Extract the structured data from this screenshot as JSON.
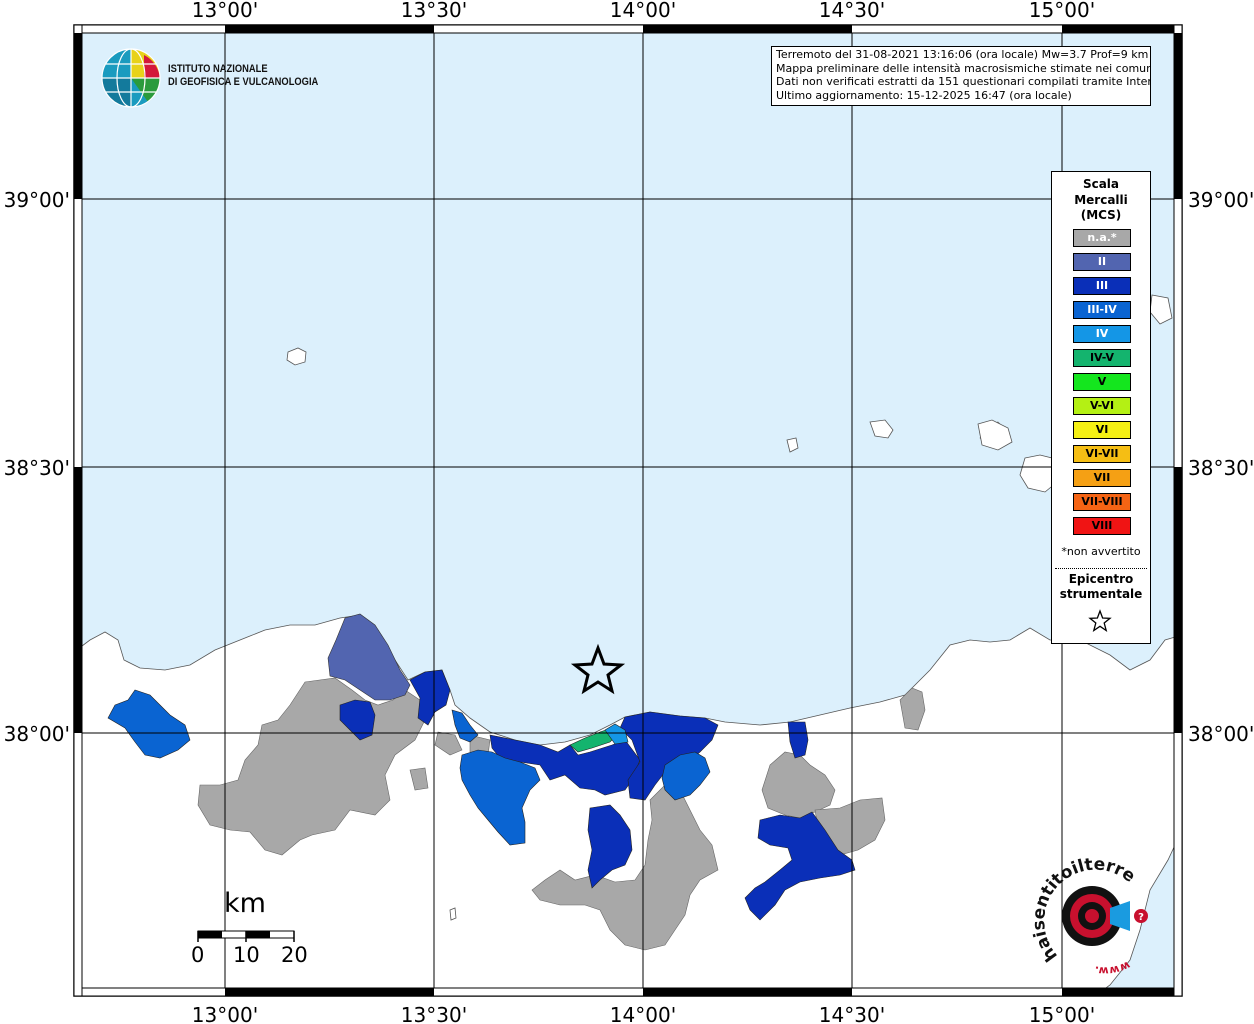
{
  "map": {
    "lon_ticks": [
      "13°00'",
      "13°30'",
      "14°00'",
      "14°30'",
      "15°00'"
    ],
    "lat_ticks": [
      "39°00'",
      "38°30'",
      "38°00'"
    ],
    "sea_color": "#dcf0fc",
    "land_color": "#ffffff",
    "no_data_color": "#a8a8a8"
  },
  "info": {
    "line1": "Terremoto del 31-08-2021 13:16:06 (ora locale) Mw=3.7 Prof=9 km",
    "line2": "Mappa preliminare delle intensità macrosismiche stimate nei comuni",
    "line3": "Dati non verificati estratti da 151 questionari compilati tramite Internet.",
    "line4": "Ultimo aggiornamento: 15-12-2025 16:47 (ora locale)"
  },
  "legend": {
    "title_line1": "Scala",
    "title_line2": "Mercalli",
    "title_line3": "(MCS)",
    "classes": [
      {
        "label": "n.a.*",
        "color": "#a8a8a8"
      },
      {
        "label": "II",
        "color": "#5265b0"
      },
      {
        "label": "III",
        "color": "#0a2fb8"
      },
      {
        "label": "III-IV",
        "color": "#0a64d2"
      },
      {
        "label": "IV",
        "color": "#1496e6"
      },
      {
        "label": "IV-V",
        "color": "#14b46e"
      },
      {
        "label": "V",
        "color": "#14e61e"
      },
      {
        "label": "V-VI",
        "color": "#b4f014"
      },
      {
        "label": "VI",
        "color": "#f5f014"
      },
      {
        "label": "VI-VII",
        "color": "#f5be14"
      },
      {
        "label": "VII",
        "color": "#f5a014"
      },
      {
        "label": "VII-VIII",
        "color": "#f56414"
      },
      {
        "label": "VIII",
        "color": "#f01414"
      }
    ],
    "na_note": "*non avvertito",
    "epicenter_line1": "Epicentro",
    "epicenter_line2": "strumentale"
  },
  "logos": {
    "ingv_line1": "ISTITUTO NAZIONALE",
    "ingv_line2": "DI GEOFISICA E VULCANOLOGIA",
    "hst_text": "haisentitoilterremoto.it",
    "hst_url": "www."
  },
  "scalebar": {
    "unit": "km",
    "labels": [
      "0",
      "10",
      "20"
    ]
  }
}
